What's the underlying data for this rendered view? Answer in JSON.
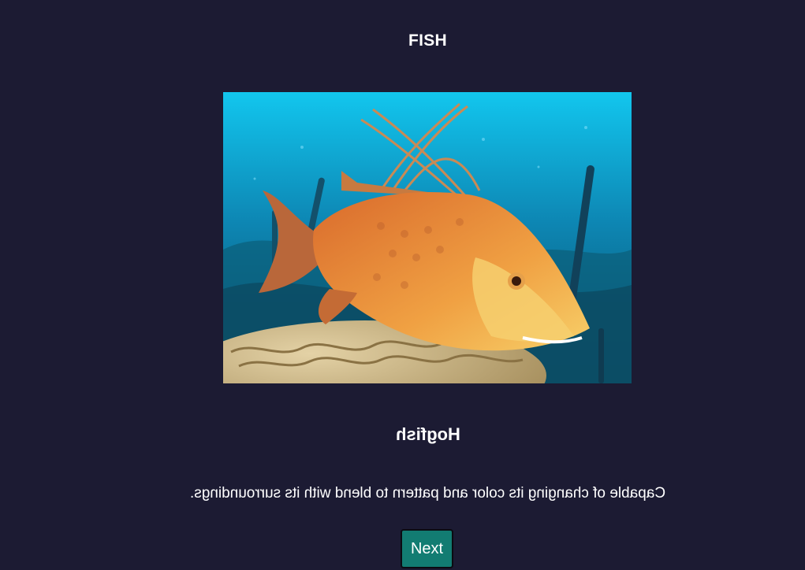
{
  "header": {
    "category": "FISH"
  },
  "card": {
    "image_alt": "Hogfish",
    "name": "Hogfish",
    "description": "Capable of changing its color and pattern to blend with its surroundings."
  },
  "actions": {
    "next_label": "Next"
  },
  "colors": {
    "background": "#1c1b33",
    "button": "#127c72",
    "text": "#ffffff"
  }
}
